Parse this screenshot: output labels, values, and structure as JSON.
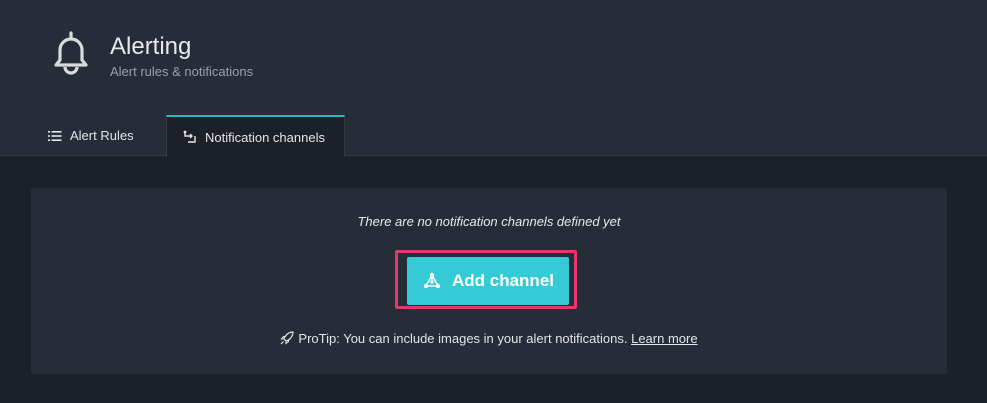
{
  "header": {
    "icon": "bell-icon",
    "title": "Alerting",
    "subtitle": "Alert rules & notifications"
  },
  "tabs": [
    {
      "label": "Alert Rules",
      "icon": "list-icon",
      "active": false
    },
    {
      "label": "Notification channels",
      "icon": "channels-icon",
      "active": true
    }
  ],
  "empty_state": {
    "message": "There are no notification channels defined yet",
    "button_label": "Add channel",
    "button_icon": "channels-icon",
    "protip_text": "ProTip: You can include images in your alert notifications.",
    "protip_icon": "rocket-icon",
    "learn_more": "Learn more"
  },
  "colors": {
    "accent": "#34cad6",
    "highlight": "#e8356c",
    "tab_active_border": "#33b5c4"
  }
}
